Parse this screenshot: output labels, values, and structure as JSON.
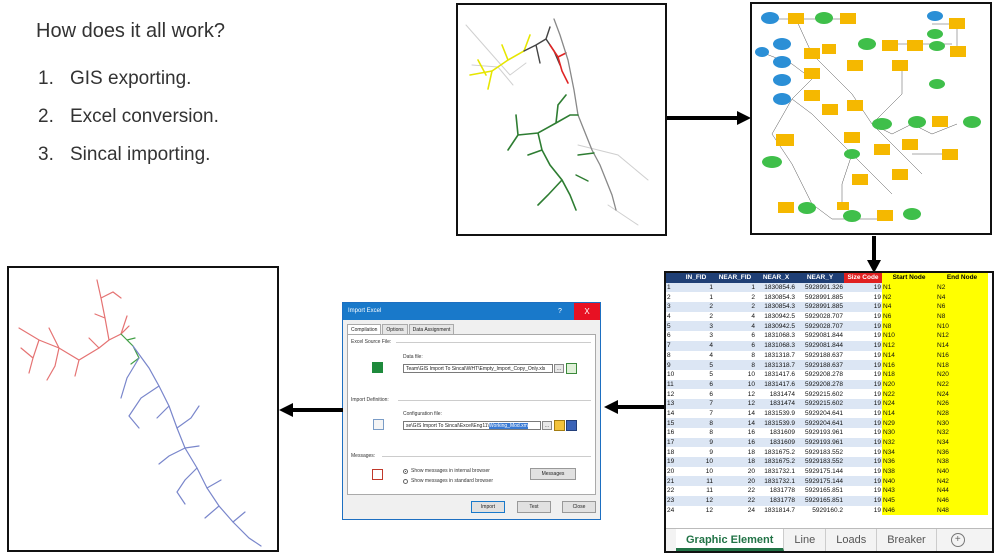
{
  "heading": "How does it all work?",
  "steps": [
    {
      "num": "1.",
      "text": "GIS exporting."
    },
    {
      "num": "2.",
      "text": "Excel conversion."
    },
    {
      "num": "3.",
      "text": "Sincal importing."
    }
  ],
  "dialog": {
    "title": "Import Excel",
    "help": "?",
    "close": "X",
    "tabs": [
      "Compilation",
      "Options",
      "Data Assignment"
    ],
    "excel_section": "Excel Source File:",
    "data_file_label": "Data file:",
    "data_file_value": "Team\\GIS Import To Sincal\\WHT\\Empty_Import_Copy_Only.xls",
    "browse": "...",
    "import_def_section": "Import Definition:",
    "config_label": "Configuration file:",
    "config_value_plain": "se\\GIS Import To Sincal\\Excel\\Eng11\\",
    "config_value_selected": "Working_Mod.xm",
    "messages_section": "Messages:",
    "radio_internal": "Show messages in internal browser",
    "radio_standard": "Show messages in standard browser",
    "messages_button": "Messages",
    "buttons": [
      "Import",
      "Test",
      "Close"
    ]
  },
  "sheet": {
    "headers": [
      "IN_FID",
      "NEAR_FID",
      "NEAR_X",
      "NEAR_Y",
      "Size Code",
      "Start Node",
      "End Node"
    ],
    "rows": [
      [
        "1",
        "1",
        "1",
        "1830854.6",
        "5928991.326",
        "19",
        "N1",
        "N2"
      ],
      [
        "2",
        "1",
        "2",
        "1830854.3",
        "5928991.885",
        "19",
        "N2",
        "N4"
      ],
      [
        "3",
        "2",
        "2",
        "1830854.3",
        "5928991.885",
        "19",
        "N4",
        "N6"
      ],
      [
        "4",
        "2",
        "4",
        "1830942.5",
        "5929028.707",
        "19",
        "N6",
        "N8"
      ],
      [
        "5",
        "3",
        "4",
        "1830942.5",
        "5929028.707",
        "19",
        "N8",
        "N10"
      ],
      [
        "6",
        "3",
        "6",
        "1831068.3",
        "5929081.844",
        "19",
        "N10",
        "N12"
      ],
      [
        "7",
        "4",
        "6",
        "1831068.3",
        "5929081.844",
        "19",
        "N12",
        "N14"
      ],
      [
        "8",
        "4",
        "8",
        "1831318.7",
        "5929188.637",
        "19",
        "N14",
        "N16"
      ],
      [
        "9",
        "5",
        "8",
        "1831318.7",
        "5929188.637",
        "19",
        "N16",
        "N18"
      ],
      [
        "10",
        "5",
        "10",
        "1831417.6",
        "5929208.278",
        "19",
        "N18",
        "N20"
      ],
      [
        "11",
        "6",
        "10",
        "1831417.6",
        "5929208.278",
        "19",
        "N20",
        "N22"
      ],
      [
        "12",
        "6",
        "12",
        "1831474",
        "5929215.602",
        "19",
        "N22",
        "N24"
      ],
      [
        "13",
        "7",
        "12",
        "1831474",
        "5929215.602",
        "19",
        "N24",
        "N26"
      ],
      [
        "14",
        "7",
        "14",
        "1831539.9",
        "5929204.641",
        "19",
        "N14",
        "N28"
      ],
      [
        "15",
        "8",
        "14",
        "1831539.9",
        "5929204.641",
        "19",
        "N29",
        "N30"
      ],
      [
        "16",
        "8",
        "16",
        "1831609",
        "5929193.961",
        "19",
        "N30",
        "N32"
      ],
      [
        "17",
        "9",
        "16",
        "1831609",
        "5929193.961",
        "19",
        "N32",
        "N34"
      ],
      [
        "18",
        "9",
        "18",
        "1831675.2",
        "5929183.552",
        "19",
        "N34",
        "N36"
      ],
      [
        "19",
        "10",
        "18",
        "1831675.2",
        "5929183.552",
        "19",
        "N36",
        "N38"
      ],
      [
        "20",
        "10",
        "20",
        "1831732.1",
        "5929175.144",
        "19",
        "N38",
        "N40"
      ],
      [
        "21",
        "11",
        "20",
        "1831732.1",
        "5929175.144",
        "19",
        "N40",
        "N42"
      ],
      [
        "22",
        "11",
        "22",
        "1831778",
        "5929165.851",
        "19",
        "N43",
        "N44"
      ],
      [
        "23",
        "12",
        "22",
        "1831778",
        "5929165.851",
        "19",
        "N45",
        "N46"
      ],
      [
        "24",
        "12",
        "24",
        "1831814.7",
        "5929160.2",
        "19",
        "N46",
        "N48"
      ]
    ],
    "tabs": [
      "Graphic Element",
      "Line",
      "Loads",
      "Breaker"
    ],
    "add_sheet": "+"
  },
  "colors": {
    "header_bg": "#1f3f75",
    "size_code_header": "#e02020",
    "node_highlight": "#ffff00",
    "dialog_accent": "#1979ca",
    "excel_green": "#217346"
  }
}
